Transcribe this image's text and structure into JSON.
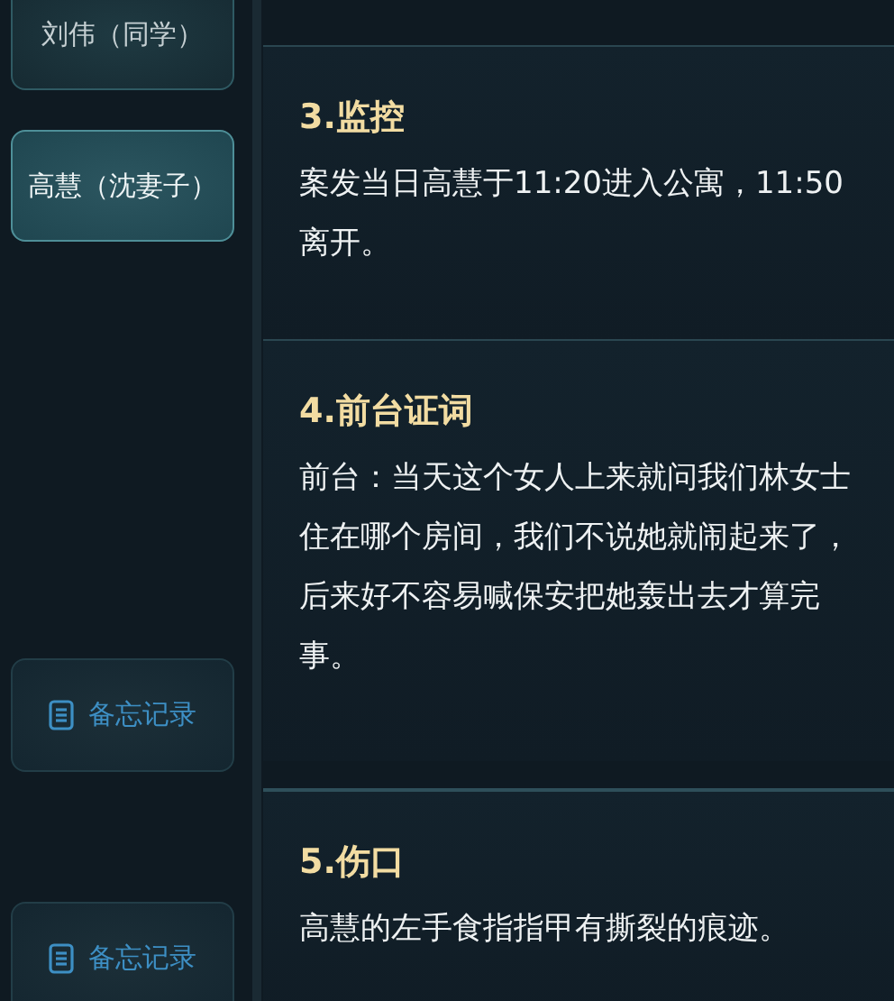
{
  "suspects": [
    {
      "name": "刘伟（同学）",
      "selected": false
    },
    {
      "name": "高慧（沈妻子）",
      "selected": true
    }
  ],
  "memo_buttons": [
    "备忘记录",
    "备忘记录"
  ],
  "clues": [
    {
      "title": "3.监控",
      "text": "案发当日高慧于11:20进入公寓，11:50离开。"
    },
    {
      "title": "4.前台证词",
      "text": "前台：当天这个女人上来就问我们林女士住在哪个房间，我们不说她就闹起来了，后来好不容易喊保安把她轰出去才算完事。"
    },
    {
      "title": "5.伤口",
      "text": "高慧的左手食指指甲有撕裂的痕迹。"
    }
  ]
}
